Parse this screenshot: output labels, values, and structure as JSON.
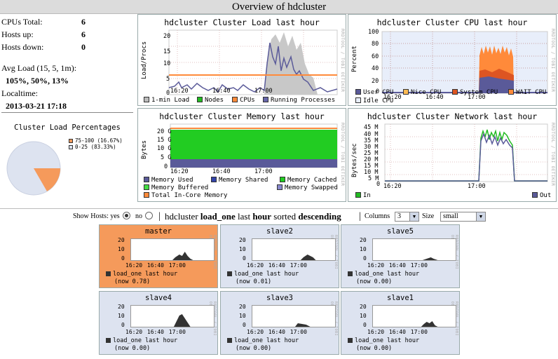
{
  "page": {
    "title": "Overview of hdcluster"
  },
  "summary": [
    {
      "label": "CPUs Total:",
      "value": "6"
    },
    {
      "label": "Hosts up:",
      "value": "6"
    },
    {
      "label": "Hosts down:",
      "value": "0"
    }
  ],
  "avg_load": {
    "label": "Avg Load (15, 5, 1m):",
    "value": "105%, 50%, 13%"
  },
  "localtime": {
    "label": "Localtime:",
    "value": "2013-03-21 17:18"
  },
  "pie": {
    "title": "Cluster Load Percentages",
    "slices": [
      {
        "label": "75-100 (16.67%)",
        "value": 16.67,
        "color": "#f59a5b"
      },
      {
        "label": "0-25 (83.33%)",
        "value": 83.33,
        "color": "#dde3f0"
      }
    ]
  },
  "rrd_label": "RRDTOOL / TOBI OETIKER",
  "graphs": {
    "load": {
      "title": "hdcluster Cluster Load last hour",
      "ylabel": "Load/Procs",
      "yticks": [
        "20",
        "15",
        "10",
        "5",
        "0"
      ],
      "xticks": [
        "16:20",
        "16:40",
        "17:00"
      ],
      "legend": [
        {
          "label": "1-min Load",
          "color": "#bbbbbb"
        },
        {
          "label": "Nodes",
          "color": "#22bb22"
        },
        {
          "label": "CPUs",
          "color": "#ff8a3a"
        },
        {
          "label": "Running Processes",
          "color": "#6666aa"
        }
      ]
    },
    "cpu": {
      "title": "hdcluster Cluster CPU last hour",
      "ylabel": "Percent",
      "yticks": [
        "100",
        "80",
        "60",
        "40",
        "20",
        "0"
      ],
      "xticks": [
        "16:20",
        "16:40",
        "17:00"
      ],
      "legend": [
        {
          "label": "User CPU",
          "color": "#5a5a99"
        },
        {
          "label": "Nice CPU",
          "color": "#ffbb55"
        },
        {
          "label": "System CPU",
          "color": "#dd5522"
        },
        {
          "label": "WAIT CPU",
          "color": "#ff8a3a"
        },
        {
          "label": "Idle CPU",
          "color": "#e8eefa"
        }
      ]
    },
    "memory": {
      "title": "hdcluster Cluster Memory last hour",
      "ylabel": "Bytes",
      "yticks": [
        "20 G",
        "15 G",
        "10 G",
        "5 G",
        "0"
      ],
      "xticks": [
        "16:20",
        "16:40",
        "17:00"
      ],
      "legend": [
        {
          "label": "Memory Used",
          "color": "#5a5a99"
        },
        {
          "label": "Memory Shared",
          "color": "#3344aa"
        },
        {
          "label": "Memory Cached",
          "color": "#22cc22"
        },
        {
          "label": "Memory Buffered",
          "color": "#44dd44"
        },
        {
          "label": "Memory Swapped",
          "color": "#8888cc"
        },
        {
          "label": "Total In-Core Memory",
          "color": "#ff8a3a"
        }
      ]
    },
    "network": {
      "title": "hdcluster Cluster Network last hour",
      "ylabel": "Bytes/sec",
      "yticks": [
        "45 M",
        "40 M",
        "35 M",
        "30 M",
        "25 M",
        "20 M",
        "15 M",
        "10 M",
        "5 M",
        "0"
      ],
      "xticks": [
        "16:20",
        "16:40",
        "17:00"
      ],
      "legend": [
        {
          "label": "In",
          "color": "#22bb22"
        },
        {
          "label": "Out",
          "color": "#5a5a99"
        }
      ]
    }
  },
  "controls": {
    "show_hosts_label": "Show Hosts: yes",
    "no_label": "no",
    "sep": "|",
    "cluster": "hdcluster",
    "metric": "load_one",
    "period_pre": "last",
    "period": "hour",
    "sorted": "sorted",
    "order": "descending",
    "columns_label": "Columns",
    "columns_value": "3",
    "size_label": "Size",
    "size_value": "small"
  },
  "host_graph": {
    "yticks": [
      "20",
      "10",
      "0"
    ],
    "xticks": "16:20 16:40 17:00"
  },
  "hosts": [
    {
      "name": "master",
      "metric": "load_one last hour",
      "now": "(now 0.78)",
      "highlight": true
    },
    {
      "name": "slave2",
      "metric": "load_one last hour",
      "now": "(now 0.01)",
      "highlight": false
    },
    {
      "name": "slave5",
      "metric": "load_one last hour",
      "now": "(now 0.00)",
      "highlight": false
    },
    {
      "name": "slave4",
      "metric": "load_one last hour",
      "now": "(now 0.00)",
      "highlight": false
    },
    {
      "name": "slave3",
      "metric": "load_one last hour",
      "now": "(now 0.00)",
      "highlight": false
    },
    {
      "name": "slave1",
      "metric": "load_one last hour",
      "now": "(now 0.00)",
      "highlight": false
    }
  ]
}
